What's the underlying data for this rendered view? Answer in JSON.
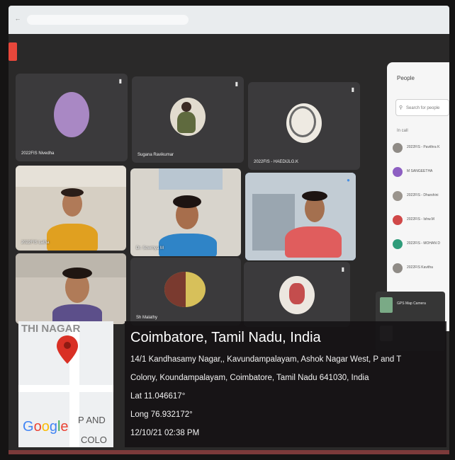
{
  "browser": {
    "url": "",
    "accent": "#e8473b"
  },
  "tiles": [
    {
      "name": "2022FIS Nivedha",
      "kind": "avatar"
    },
    {
      "name": "Sugana Ravikumar",
      "kind": "avatar"
    },
    {
      "name": "2022FIS - HAEDIJLG.K",
      "kind": "avatar"
    },
    {
      "name": "2022FIS Latha ",
      "kind": "video"
    },
    {
      "name": "Dr. Sowmya M",
      "kind": "video"
    },
    {
      "name": "",
      "kind": "video-active"
    },
    {
      "name": "",
      "kind": "video"
    },
    {
      "name": "Sh Malathy",
      "kind": "avatar"
    },
    {
      "name": "",
      "kind": "avatar"
    }
  ],
  "people_panel": {
    "title": "People",
    "search_placeholder": "Search for people",
    "section": "In call",
    "members": [
      {
        "name": "2022FIS - Pavithra K",
        "color": "#8f8b86"
      },
      {
        "name": "M SANGEETHA",
        "color": "#8d5fc2"
      },
      {
        "name": "2022FIS - Dharshini",
        "color": "#9a948d"
      },
      {
        "name": "2022FIS - Ishw.M",
        "color": "#d04848"
      },
      {
        "name": "2022FIS - MOHAN D",
        "color": "#2f9c7a"
      },
      {
        "name": "2022FIS Kavitha",
        "color": "#8f8b86"
      }
    ]
  },
  "toast": {
    "text": "GPS Map Camera"
  },
  "gps": {
    "city": "Coimbatore, Tamil Nadu, India",
    "address_line1": "14/1 Kandhasamy Nagar,, Kavundampalayam, Ashok Nagar West, P and T",
    "address_line2": "Colony, Koundampalayam, Coimbatore, Tamil Nadu 641030, India",
    "lat": "Lat 11.046617°",
    "long": "Long 76.932172°",
    "datetime": "12/10/21 02:38 PM"
  },
  "map": {
    "label_top": "THI NAGAR",
    "label_p": "P AND",
    "label_colo": "COLO",
    "brand": [
      "G",
      "o",
      "o",
      "g",
      "l",
      "e"
    ],
    "brand_colors": [
      "#4285f4",
      "#ea4335",
      "#fbbc05",
      "#4285f4",
      "#34a853",
      "#ea4335"
    ],
    "pin_color": "#d93025"
  }
}
